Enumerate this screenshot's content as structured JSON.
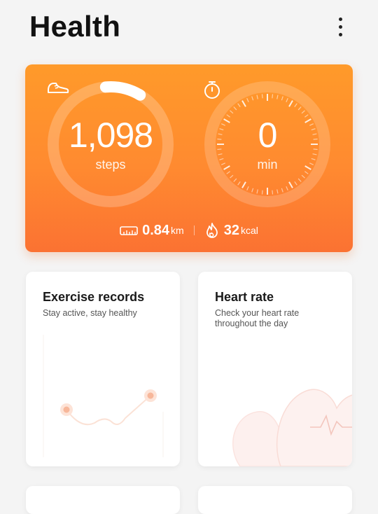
{
  "header": {
    "title": "Health"
  },
  "summary": {
    "steps": {
      "value": "1,098",
      "unit": "steps",
      "progress": 0.1
    },
    "time": {
      "value": "0",
      "unit": "min"
    },
    "distance": {
      "value": "0.84",
      "unit": "km"
    },
    "calories": {
      "value": "32",
      "unit": "kcal"
    }
  },
  "cards": [
    {
      "title": "Exercise records",
      "subtitle": "Stay active, stay healthy"
    },
    {
      "title": "Heart rate",
      "subtitle": "Check your heart rate throughout the day"
    }
  ],
  "colors": {
    "accent": "#ff8a30",
    "accent_dark": "#fb7232"
  }
}
